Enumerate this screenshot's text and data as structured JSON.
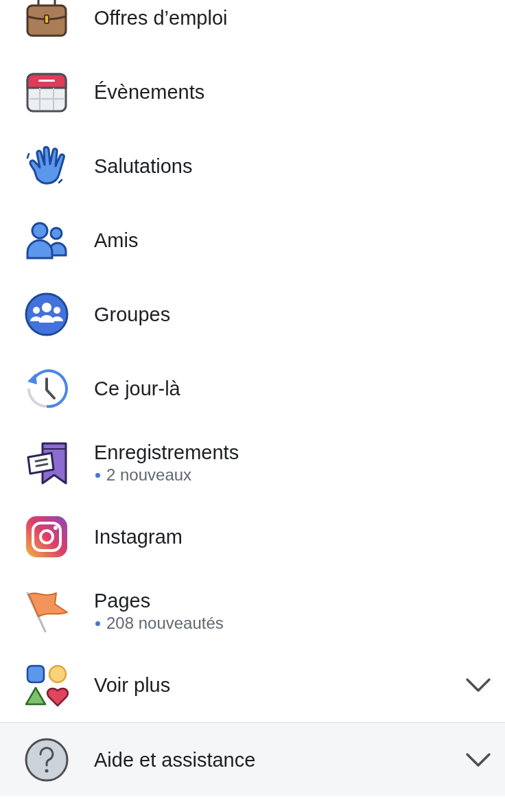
{
  "menu_items": [
    {
      "label": "Offres d’emploi",
      "kind": "link"
    },
    {
      "label": "Évènements",
      "kind": "link"
    },
    {
      "label": "Salutations",
      "kind": "link"
    },
    {
      "label": "Amis",
      "kind": "link"
    },
    {
      "label": "Groupes",
      "kind": "link"
    },
    {
      "label": "Ce jour-là",
      "kind": "link"
    },
    {
      "label": "Enregistrements",
      "kind": "link",
      "subtitle": "2 nouveaux"
    },
    {
      "label": "Instagram",
      "kind": "link"
    },
    {
      "label": "Pages",
      "kind": "link",
      "subtitle": "208 nouveautés"
    },
    {
      "label": "Voir plus",
      "kind": "expandable",
      "expanded": false
    }
  ],
  "help_section": {
    "label": "Aide et assistance",
    "expanded": false
  }
}
